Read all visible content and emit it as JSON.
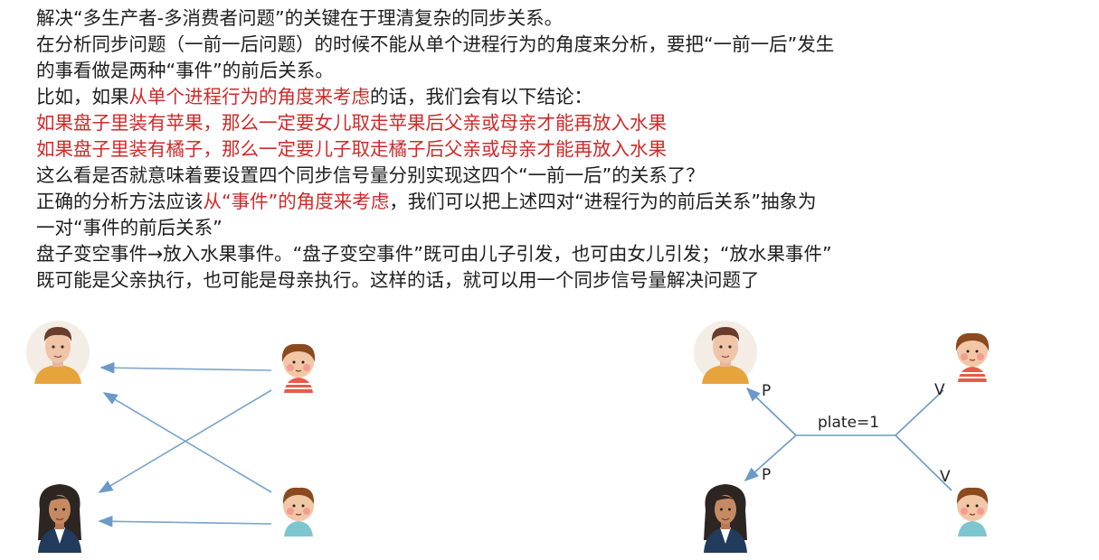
{
  "text": {
    "line1": "解决“多生产者-多消费者问题”的关键在于理清复杂的同步关系。",
    "line2": "在分析同步问题（一前一后问题）的时候不能从单个进程行为的角度来分析，要把“一前一后”发生",
    "line3": "的事看做是两种“事件”的前后关系。",
    "line4_a": "比如，如果",
    "line4_b": "从单个进程行为的角度来考虑",
    "line4_c": "的话，我们会有以下结论：",
    "line5": "如果盘子里装有苹果，那么一定要女儿取走苹果后父亲或母亲才能再放入水果",
    "line6": "如果盘子里装有橘子，那么一定要儿子取走橘子后父亲或母亲才能再放入水果",
    "line7": "这么看是否就意味着要设置四个同步信号量分别实现这四个“一前一后”的关系了？",
    "line8_a": "正确的分析方法应该",
    "line8_b": "从“事件”的角度来考虑",
    "line8_c": "，我们可以把上述四对“进程行为的前后关系”抽象为",
    "line9": "一对“事件的前后关系”",
    "line10": "盘子变空事件→放入水果事件。“盘子变空事件”既可由儿子引发，也可由女儿引发；“放水果事件”",
    "line11": "既可能是父亲执行，也可能是母亲执行。这样的话，就可以用一个同步信号量解决问题了"
  },
  "diagram_right": {
    "center_label": "plate=1",
    "label_p_top": "P",
    "label_p_bottom": "P",
    "label_v_top": "V",
    "label_v_bottom": "V"
  },
  "colors": {
    "text": "#1e1e1e",
    "highlight": "#cf2a2a",
    "arrow": "#7aa3cc",
    "line": "#6b9ac8"
  },
  "icons": [
    "father-avatar-icon",
    "mother-avatar-icon",
    "daughter-avatar-icon",
    "son-avatar-icon"
  ]
}
